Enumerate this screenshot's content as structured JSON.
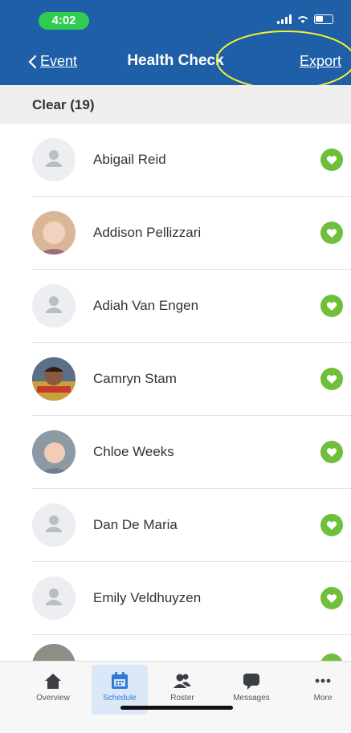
{
  "status_bar": {
    "time": "4:02"
  },
  "header": {
    "back_label": "Event",
    "title": "Health Check",
    "export_label": "Export",
    "background": "#1f5fa8"
  },
  "section": {
    "label": "Clear (19)"
  },
  "people": [
    {
      "name": "Abigail Reid",
      "avatar": "default-user-icon",
      "status": "clear-heart-icon"
    },
    {
      "name": "Addison Pellizzari",
      "avatar": "photo",
      "status": "clear-heart-icon"
    },
    {
      "name": "Adiah Van Engen",
      "avatar": "default-user-icon",
      "status": "clear-heart-icon"
    },
    {
      "name": "Camryn Stam",
      "avatar": "photo",
      "status": "clear-heart-icon"
    },
    {
      "name": "Chloe Weeks",
      "avatar": "photo",
      "status": "clear-heart-icon"
    },
    {
      "name": "Dan De Maria",
      "avatar": "default-user-icon",
      "status": "clear-heart-icon"
    },
    {
      "name": "Emily Veldhuyzen",
      "avatar": "default-user-icon",
      "status": "clear-heart-icon"
    }
  ],
  "tabs": [
    {
      "label": "Overview",
      "icon": "home-icon",
      "active": false
    },
    {
      "label": "Schedule",
      "icon": "calendar-icon",
      "active": true
    },
    {
      "label": "Roster",
      "icon": "roster-icon",
      "active": false
    },
    {
      "label": "Messages",
      "icon": "chat-icon",
      "active": false
    },
    {
      "label": "More",
      "icon": "more-dots-icon",
      "active": false
    }
  ],
  "colors": {
    "accent": "#2f7ad8",
    "status_green": "#6fbf3a",
    "highlight": "#f2f230"
  }
}
